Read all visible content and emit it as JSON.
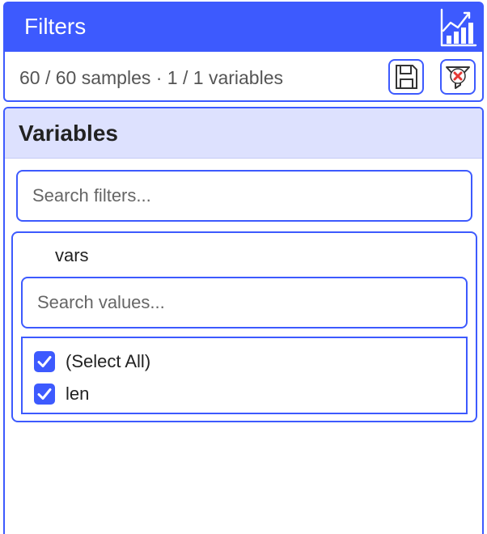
{
  "header": {
    "title": "Filters"
  },
  "summary": {
    "text": "60 / 60 samples · 1 / 1 variables"
  },
  "panel": {
    "title": "Variables",
    "search": {
      "placeholder": "Search filters...",
      "value": ""
    },
    "filter": {
      "variable": "vars",
      "search": {
        "placeholder": "Search values...",
        "value": ""
      },
      "options": [
        {
          "label": "(Select All)",
          "checked": true
        },
        {
          "label": "len",
          "checked": true
        }
      ]
    }
  },
  "icons": {
    "header": "bar-chart-icon",
    "save": "save-icon",
    "clear": "clear-filter-icon",
    "check": "check-icon"
  },
  "colors": {
    "accent": "#3d5afe",
    "panel_header_bg": "#dde1fe",
    "clear_x": "#e53935"
  }
}
